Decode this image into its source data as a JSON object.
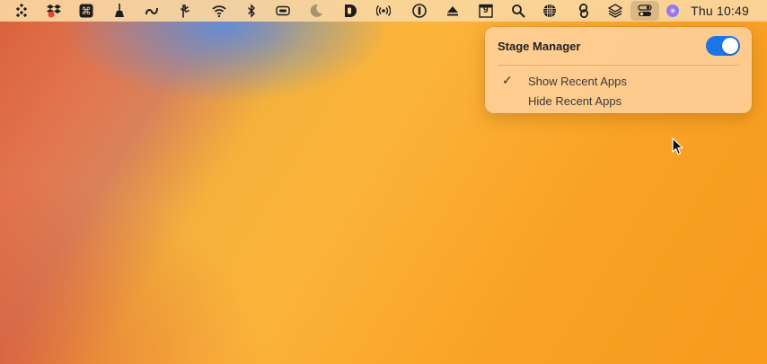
{
  "menubar": {
    "icons": [
      "bartender-icon",
      "dropbox-icon",
      "command-icon",
      "broom-icon",
      "infinity-icon",
      "hand-gesture-icon",
      "wifi-icon",
      "bluetooth-icon",
      "battery-icon",
      "moon-icon",
      "d-app-icon",
      "broadcast-icon",
      "1password-icon",
      "eject-icon",
      "calendar-icon",
      "search-icon",
      "globe-grid-icon",
      "link-icon",
      "layers-icon",
      "control-center-icon",
      "siri-icon"
    ],
    "calendar_day": "9",
    "clock": "Thu 10:49"
  },
  "popover": {
    "title": "Stage Manager",
    "toggle_on": true,
    "items": [
      {
        "label": "Show Recent Apps",
        "checked": true,
        "check_mark": "✓"
      },
      {
        "label": "Hide Recent Apps",
        "checked": false,
        "check_mark": ""
      }
    ]
  },
  "colors": {
    "accent": "#1b74e8",
    "desktop_orange": "#f9a326"
  }
}
